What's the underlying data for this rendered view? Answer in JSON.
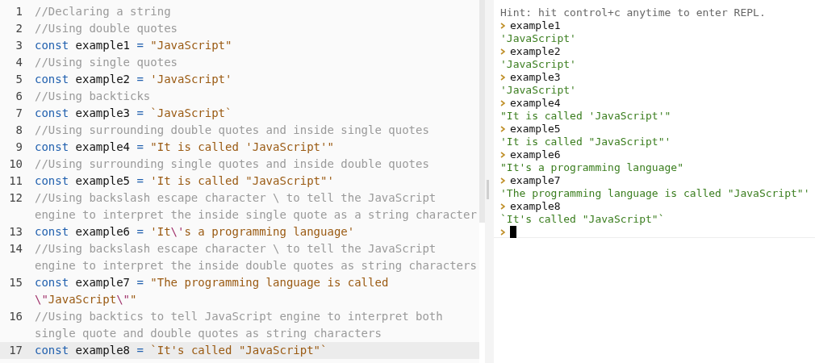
{
  "editor": {
    "lines": [
      {
        "number": "1",
        "active": false,
        "parts": [
          {
            "kind": "comment",
            "text": "//Declaring a string"
          }
        ]
      },
      {
        "number": "2",
        "active": false,
        "parts": [
          {
            "kind": "comment",
            "text": "//Using double quotes"
          }
        ]
      },
      {
        "number": "3",
        "active": false,
        "parts": [
          {
            "kind": "keyword",
            "text": "const"
          },
          {
            "kind": "variable",
            "text": " example1 "
          },
          {
            "kind": "operator",
            "text": "= "
          },
          {
            "kind": "string",
            "text": "\"JavaScript\""
          }
        ]
      },
      {
        "number": "4",
        "active": false,
        "parts": [
          {
            "kind": "comment",
            "text": "//Using single quotes"
          }
        ]
      },
      {
        "number": "5",
        "active": false,
        "parts": [
          {
            "kind": "keyword",
            "text": "const"
          },
          {
            "kind": "variable",
            "text": " example2 "
          },
          {
            "kind": "operator",
            "text": "= "
          },
          {
            "kind": "string",
            "text": "'JavaScript'"
          }
        ]
      },
      {
        "number": "6",
        "active": false,
        "parts": [
          {
            "kind": "comment",
            "text": "//Using backticks"
          }
        ]
      },
      {
        "number": "7",
        "active": false,
        "parts": [
          {
            "kind": "keyword",
            "text": "const"
          },
          {
            "kind": "variable",
            "text": " example3 "
          },
          {
            "kind": "operator",
            "text": "= "
          },
          {
            "kind": "string",
            "text": "`JavaScript`"
          }
        ]
      },
      {
        "number": "8",
        "active": false,
        "parts": [
          {
            "kind": "comment",
            "text": "//Using surrounding double quotes and inside single quotes"
          }
        ]
      },
      {
        "number": "9",
        "active": false,
        "parts": [
          {
            "kind": "keyword",
            "text": "const"
          },
          {
            "kind": "variable",
            "text": " example4 "
          },
          {
            "kind": "operator",
            "text": "= "
          },
          {
            "kind": "string",
            "text": "\"It is called 'JavaScript'\""
          }
        ]
      },
      {
        "number": "10",
        "active": false,
        "parts": [
          {
            "kind": "comment",
            "text": "//Using surrounding single quotes and inside double quotes"
          }
        ]
      },
      {
        "number": "11",
        "active": false,
        "parts": [
          {
            "kind": "keyword",
            "text": "const"
          },
          {
            "kind": "variable",
            "text": " example5 "
          },
          {
            "kind": "operator",
            "text": "= "
          },
          {
            "kind": "string",
            "text": "'It is called \"JavaScript\"'"
          }
        ]
      },
      {
        "number": "12",
        "active": false,
        "parts": [
          {
            "kind": "comment",
            "text": "//Using backslash escape character \\ to tell the JavaScript engine to interpret the inside single quote as a string character"
          }
        ]
      },
      {
        "number": "13",
        "active": false,
        "parts": [
          {
            "kind": "keyword",
            "text": "const"
          },
          {
            "kind": "variable",
            "text": " example6 "
          },
          {
            "kind": "operator",
            "text": "= "
          },
          {
            "kind": "string",
            "text": "'It"
          },
          {
            "kind": "escape",
            "text": "\\'"
          },
          {
            "kind": "string",
            "text": "s a programming language'"
          }
        ]
      },
      {
        "number": "14",
        "active": false,
        "parts": [
          {
            "kind": "comment",
            "text": "//Using backslash escape character \\ to tell the JavaScript engine to interpret the inside double quotes as string characters"
          }
        ]
      },
      {
        "number": "15",
        "active": false,
        "parts": [
          {
            "kind": "keyword",
            "text": "const"
          },
          {
            "kind": "variable",
            "text": " example7 "
          },
          {
            "kind": "operator",
            "text": "= "
          },
          {
            "kind": "string",
            "text": "\"The programming language is called "
          },
          {
            "kind": "escape",
            "text": "\\\""
          },
          {
            "kind": "string",
            "text": "JavaScript"
          },
          {
            "kind": "escape",
            "text": "\\\""
          },
          {
            "kind": "string",
            "text": "\""
          }
        ]
      },
      {
        "number": "16",
        "active": false,
        "parts": [
          {
            "kind": "comment",
            "text": "//Using backtics to tell JavaScript engine to interpret both single quote and double quotes as string characters"
          }
        ]
      },
      {
        "number": "17",
        "active": true,
        "parts": [
          {
            "kind": "keyword",
            "text": "const"
          },
          {
            "kind": "variable",
            "text": " example8 "
          },
          {
            "kind": "operator",
            "text": "= "
          },
          {
            "kind": "string",
            "text": "`It's called \"JavaScript\"`"
          }
        ]
      }
    ]
  },
  "console": {
    "hint": "Hint: hit control+c anytime to enter REPL.",
    "entries": [
      {
        "input": "example1",
        "output": "'JavaScript'"
      },
      {
        "input": "example2",
        "output": "'JavaScript'"
      },
      {
        "input": "example3",
        "output": "'JavaScript'"
      },
      {
        "input": "example4",
        "output": "\"It is called 'JavaScript'\""
      },
      {
        "input": "example5",
        "output": "'It is called \"JavaScript\"'"
      },
      {
        "input": "example6",
        "output": "\"It's a programming language\""
      },
      {
        "input": "example7",
        "output": "'The programming language is called \"JavaScript\"'"
      },
      {
        "input": "example8",
        "output": "`It's called \"JavaScript\"`"
      }
    ]
  }
}
